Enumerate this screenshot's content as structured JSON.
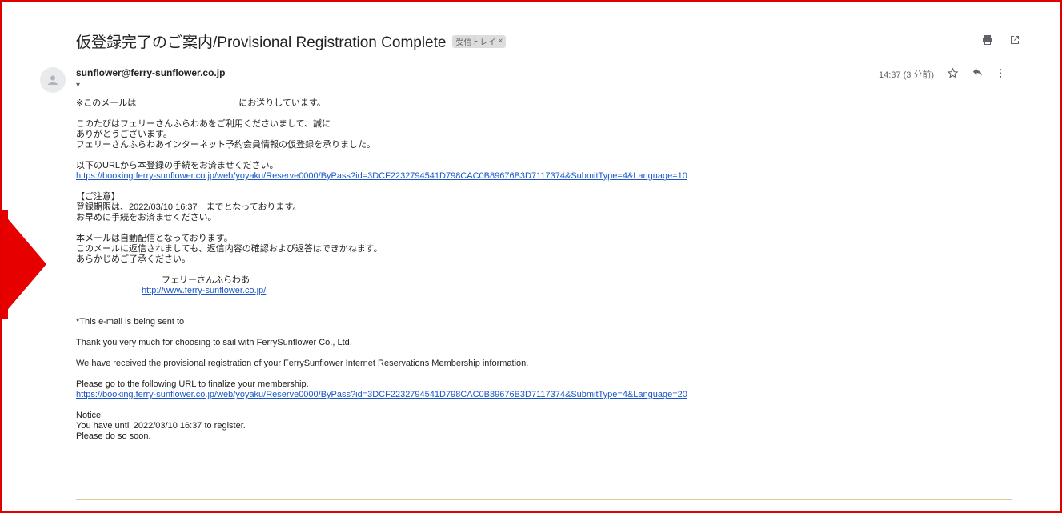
{
  "email": {
    "subject": "仮登録完了のご案内/Provisional Registration Complete",
    "label": "受信トレイ",
    "label_close": "×",
    "sender": "sunflower@ferry-sunflower.co.jp",
    "to_toggle": "▾",
    "time": "14:37 (3 分前)"
  },
  "body": {
    "jp_line1_prefix": "※このメールは",
    "jp_line1_suffix": "にお送りしています。",
    "jp_thanks_1": "このたびはフェリーさんふらわあをご利用くださいまして、誠に",
    "jp_thanks_2": "ありがとうございます。",
    "jp_thanks_3": "フェリーさんふらわあインターネット予約会員情報の仮登録を承りました。",
    "jp_url_intro": "以下のURLから本登録の手続をお済ませください。",
    "jp_url": "https://booking.ferry-sunflower.co.jp/web/yoyaku/Reserve0000/ByPass?id=3DCF2232794541D798CAC0B89676B3D7117374&SubmitType=4&Language=10",
    "jp_notice_title": "【ご注意】",
    "jp_notice_1": "登録期限は、2022/03/10 16:37　までとなっております。",
    "jp_notice_2": "お早めに手続をお済ませください。",
    "jp_auto_1": "本メールは自動配信となっております。",
    "jp_auto_2": "このメールに返信されましても、返信内容の確認および返答はできかねます。",
    "jp_auto_3": "あらかじめご了承ください。",
    "jp_sig_name": "フェリーさんふらわあ",
    "jp_sig_url": "http://www.ferry-sunflower.co.jp/",
    "en_sent_to": "*This e-mail is being sent to",
    "en_thanks": "Thank you very much for choosing to sail with FerrySunflower Co., Ltd.",
    "en_received": "We have received the provisional registration of your FerrySunflower Internet Reservations Membership information.",
    "en_url_intro": "Please go to the following URL to finalize your membership.",
    "en_url": "https://booking.ferry-sunflower.co.jp/web/yoyaku/Reserve0000/ByPass?id=3DCF2232794541D798CAC0B89676B3D7117374&SubmitType=4&Language=20",
    "en_notice_title": "Notice",
    "en_notice_1": "You have until 2022/03/10 16:37 to register.",
    "en_notice_2": "Please do so soon."
  },
  "colors": {
    "highlight": "#e60000",
    "link": "#1a56c9"
  }
}
